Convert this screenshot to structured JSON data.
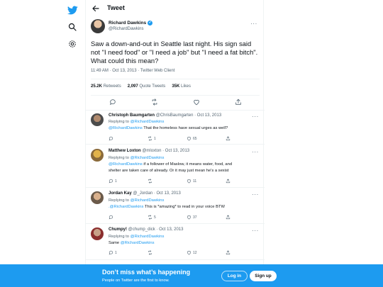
{
  "header": {
    "title": "Tweet"
  },
  "tweet": {
    "author_name": "Richard Dawkins",
    "author_handle": "@RichardDawkins",
    "text": "Saw a down-and-out in Seattle last night. His sign said not \"I need food\" or \"I need a job\" but \"I need a fat bitch\". What could this mean?",
    "meta": "11:49 AM · Oct 13, 2013 · Twitter Web Client",
    "retweets_count": "25.2K",
    "retweets_label": "Retweets",
    "quotes_count": "2,097",
    "quotes_label": "Quote Tweets",
    "likes_count": "35K",
    "likes_label": "Likes"
  },
  "replies": [
    {
      "name": "Christoph Baumgarten",
      "handle_date": "@ChrisBaumgarten · Oct 13, 2013",
      "replying_prefix": "Replying to ",
      "replying_to": "@RichardDawkins",
      "mention": "@RichardDawkins",
      "text1": " That the homeless have sexual urges as well?",
      "text2": "",
      "reply_count": "",
      "retweet_count": "1",
      "like_count": "65"
    },
    {
      "name": "Matthew Loxton",
      "handle_date": "@mloxton · Oct 13, 2013",
      "replying_prefix": "Replying to ",
      "replying_to": "@RichardDawkins",
      "mention": "@RichardDawkins",
      "text1": " if a follower of Maslow, it means water,  food,  and",
      "text2": "shelter are taken care of already.  Or it may just mean he's a sexist",
      "reply_count": "1",
      "retweet_count": "",
      "like_count": "11"
    },
    {
      "name": "Jordan Kay",
      "handle_date": "@_Jordan · Oct 13, 2013",
      "replying_prefix": "Replying to ",
      "replying_to": "@RichardDawkins",
      "mention": ".@RichardDawkins",
      "text1": " This is *amazing* to read in your voice BTW",
      "text2": "",
      "reply_count": "",
      "retweet_count": "5",
      "like_count": "37"
    },
    {
      "name": "Chumpy!",
      "handle_date": "@chump_dick · Oct 13, 2013",
      "replying_prefix": "Replying to ",
      "replying_to": "@RichardDawkins",
      "mention": "",
      "text1": "Same ",
      "text1_link": "@RichardDawkins",
      "text2": "",
      "reply_count": "1",
      "retweet_count": "",
      "like_count": "12"
    }
  ],
  "banner": {
    "title": "Don’t miss what’s happening",
    "subtitle": "People on Twitter are the first to know.",
    "login_label": "Log in",
    "signup_label": "Sign up"
  },
  "icons": {
    "logo": "twitter-bird-icon",
    "explore": "search-icon",
    "settings": "gear-icon",
    "back": "arrow-left-icon",
    "more": "more-dots-icon",
    "reply": "reply-icon",
    "retweet": "retweet-icon",
    "like": "heart-icon",
    "share": "share-icon",
    "verified": "verified-badge-icon"
  },
  "colors": {
    "accent": "#1d9bf0",
    "text": "#0f1419",
    "muted": "#536471"
  }
}
